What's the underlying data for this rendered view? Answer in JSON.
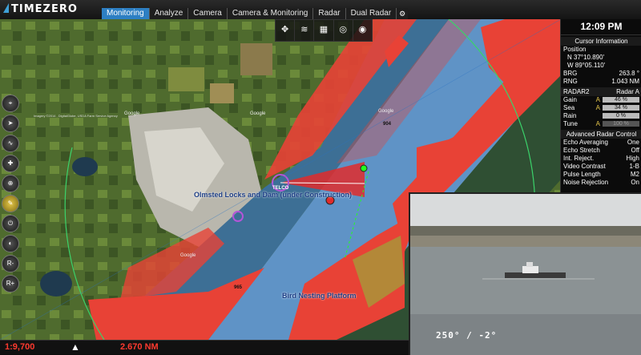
{
  "app": {
    "name": "TIMEZERO"
  },
  "tabs": [
    {
      "label": "Monitoring",
      "active": true
    },
    {
      "label": "Analyze"
    },
    {
      "label": "Camera"
    },
    {
      "label": "Camera & Monitoring"
    },
    {
      "label": "Radar"
    },
    {
      "label": "Dual Radar"
    }
  ],
  "toolbar_icons": [
    "compass-icon",
    "route-icon",
    "chart-icon",
    "radar-icon",
    "camera-icon"
  ],
  "left_tools": [
    "measure-icon",
    "pointer-icon",
    "route-icon",
    "mark-icon",
    "zoom-icon",
    "ruler-icon",
    "power-icon",
    "orbit-icon",
    "range-in-icon",
    "range-out-icon"
  ],
  "panel": {
    "time": "12:09 PM",
    "cursor": {
      "title": "Cursor Information",
      "position_label": "Position",
      "lat": "N 37°10.890'",
      "lon": "W 89°05.110'",
      "brg_label": "BRG",
      "brg": "263.8 °",
      "rng_label": "RNG",
      "rng": "1.043 NM"
    },
    "radar": {
      "name": "RADAR2",
      "sub": "Radar A",
      "gain_label": "Gain",
      "gain_mode": "A",
      "gain": "46 %",
      "sea_label": "Sea",
      "sea_mode": "A",
      "sea": "34 %",
      "rain_label": "Rain",
      "rain": "0 %",
      "tune_label": "Tune",
      "tune_mode": "A",
      "tune": "100 %"
    },
    "advanced": {
      "title": "Advanced Radar Control",
      "rows": [
        {
          "label": "Echo Averaging",
          "value": "One"
        },
        {
          "label": "Echo Stretch",
          "value": "Off"
        },
        {
          "label": "Int. Reject.",
          "value": "High"
        },
        {
          "label": "Video Contrast",
          "value": "1-B"
        },
        {
          "label": "Pulse Length",
          "value": "M2"
        },
        {
          "label": "Noise Rejection",
          "value": "On"
        }
      ]
    }
  },
  "map": {
    "label_lock": "Olmsted Locks and Dam (under Construction)",
    "label_platform": "Bird Nesting Platform",
    "label_telco": "TELCO",
    "depth_1": "904",
    "depth_2": "965",
    "google_1": "Google",
    "google_2": "Google",
    "google_3": "Google",
    "google_4": "Google",
    "imagery_credit": "Imagery ©2014 , DigitalGlobe, USDA Farm Service Agency"
  },
  "video": {
    "overlay": "250° / -2°"
  },
  "status": {
    "scale": "1:9,700",
    "range": "2.670 NM"
  },
  "colors": {
    "tab_active": "#2d7fc3",
    "radar_echo": "#f0413a",
    "water": "#5f93c6",
    "status_red": "#ff3a2f"
  }
}
